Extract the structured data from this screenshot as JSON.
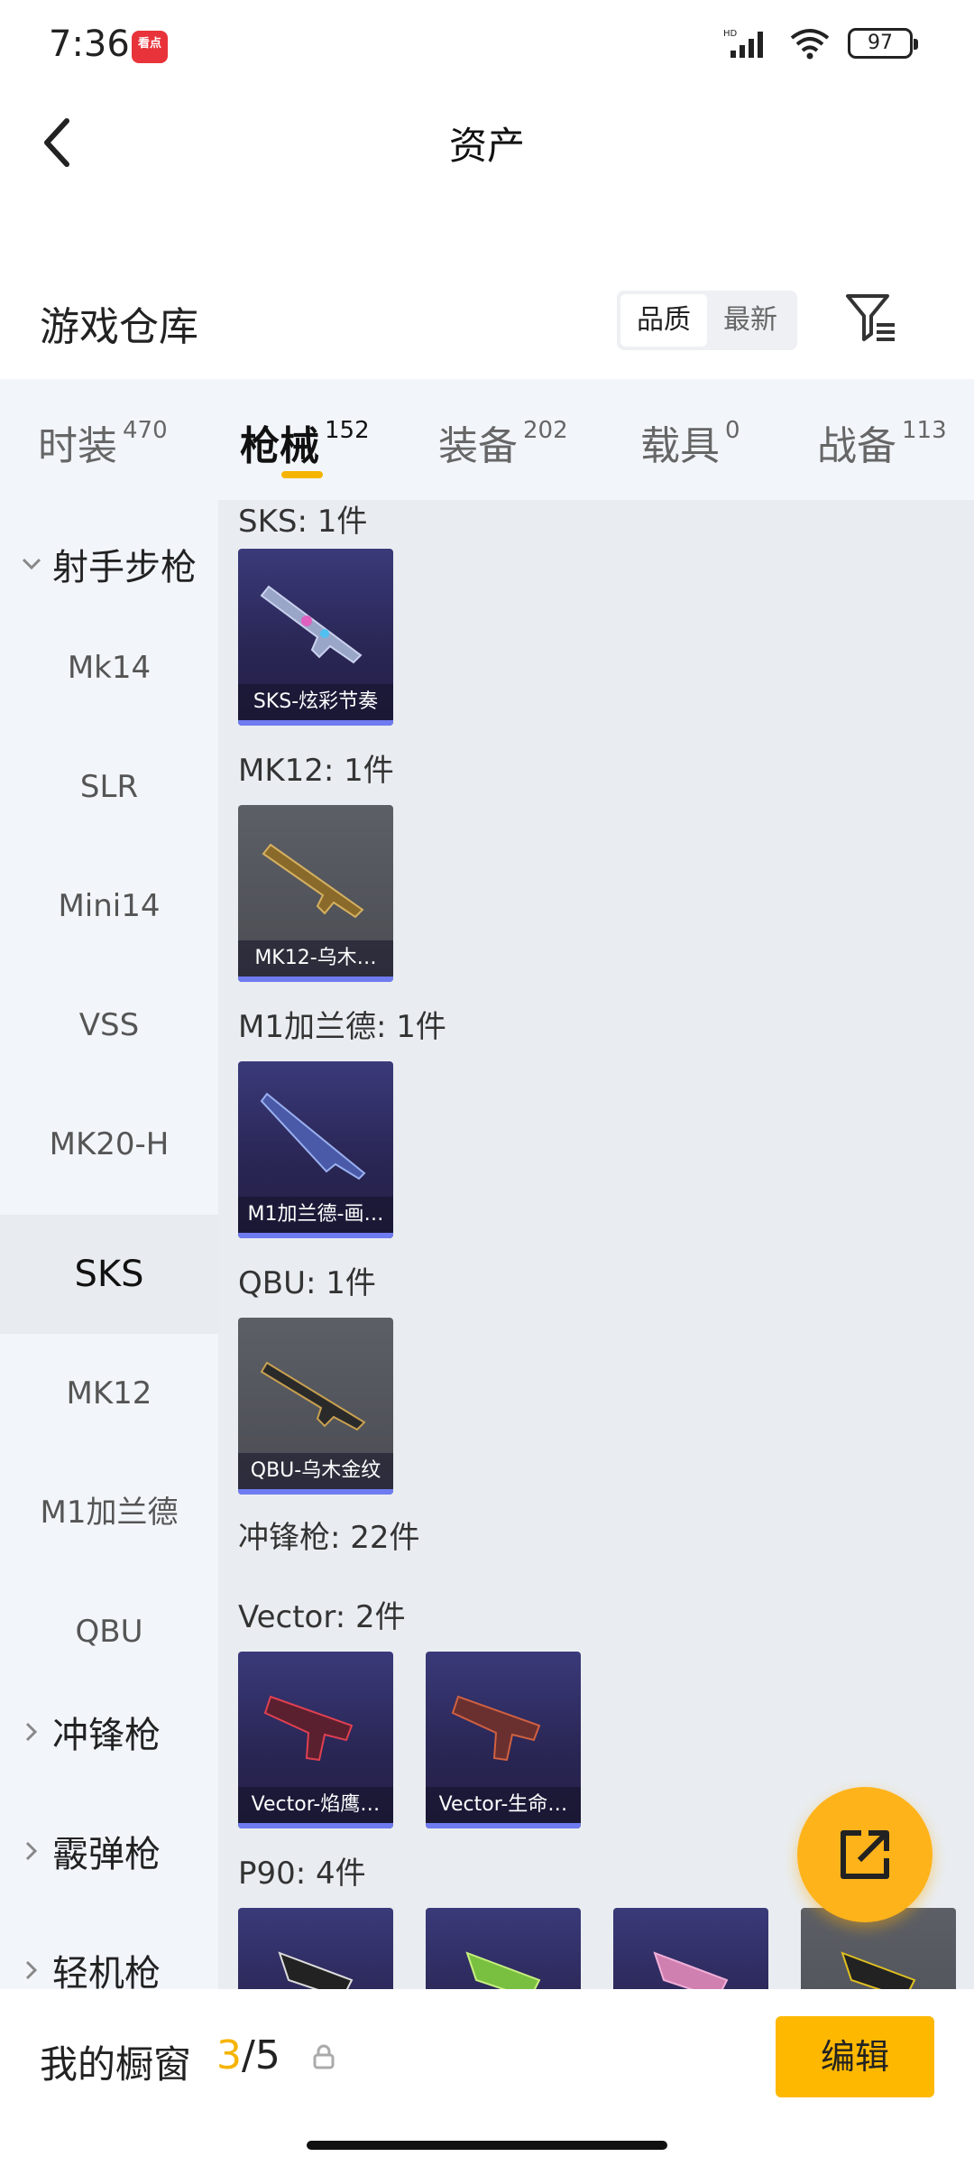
{
  "status": {
    "time": "7:36",
    "app_badge": "看点",
    "network": "HD",
    "battery": "97"
  },
  "header": {
    "title": "资产"
  },
  "warehouse": {
    "title": "游戏仓库",
    "sort_options": [
      "品质",
      "最新"
    ]
  },
  "tabs": [
    {
      "label": "时装",
      "count": "470"
    },
    {
      "label": "枪械",
      "count": "152"
    },
    {
      "label": "装备",
      "count": "202"
    },
    {
      "label": "载具",
      "count": "0"
    },
    {
      "label": "战备",
      "count": "113"
    }
  ],
  "side_menu": {
    "group_sniper": "射手步枪",
    "items": [
      "Mk14",
      "SLR",
      "Mini14",
      "VSS",
      "MK20-H",
      "SKS",
      "MK12",
      "M1加兰德",
      "QBU"
    ],
    "group_smg": "冲锋枪",
    "group_shotgun": "霰弹枪",
    "group_lmg": "轻机枪"
  },
  "content": {
    "sections": [
      {
        "label": "SKS: 1件",
        "cards": [
          {
            "name": "SKS-炫彩节奏",
            "rarity": "purple"
          }
        ]
      },
      {
        "label": "MK12: 1件",
        "cards": [
          {
            "name": "MK12-乌木…",
            "rarity": "gray"
          }
        ]
      },
      {
        "label": "M1加兰德: 1件",
        "cards": [
          {
            "name": "M1加兰德-画…",
            "rarity": "purple"
          }
        ]
      },
      {
        "label": "QBU: 1件",
        "cards": [
          {
            "name": "QBU-乌木金纹",
            "rarity": "gray"
          }
        ]
      }
    ],
    "smg_total": "冲锋枪: 22件",
    "vector": {
      "label": "Vector: 2件",
      "cards": [
        {
          "name": "Vector-焰鹰…"
        },
        {
          "name": "Vector-生命…"
        }
      ]
    },
    "p90": {
      "label": "P90: 4件"
    }
  },
  "bottom": {
    "label": "我的橱窗",
    "current": "3",
    "total": "/5",
    "edit": "编辑"
  },
  "colors": {
    "accent": "#f5b400",
    "purple_card": "#2a2655",
    "gray_card": "#4a4c52"
  }
}
